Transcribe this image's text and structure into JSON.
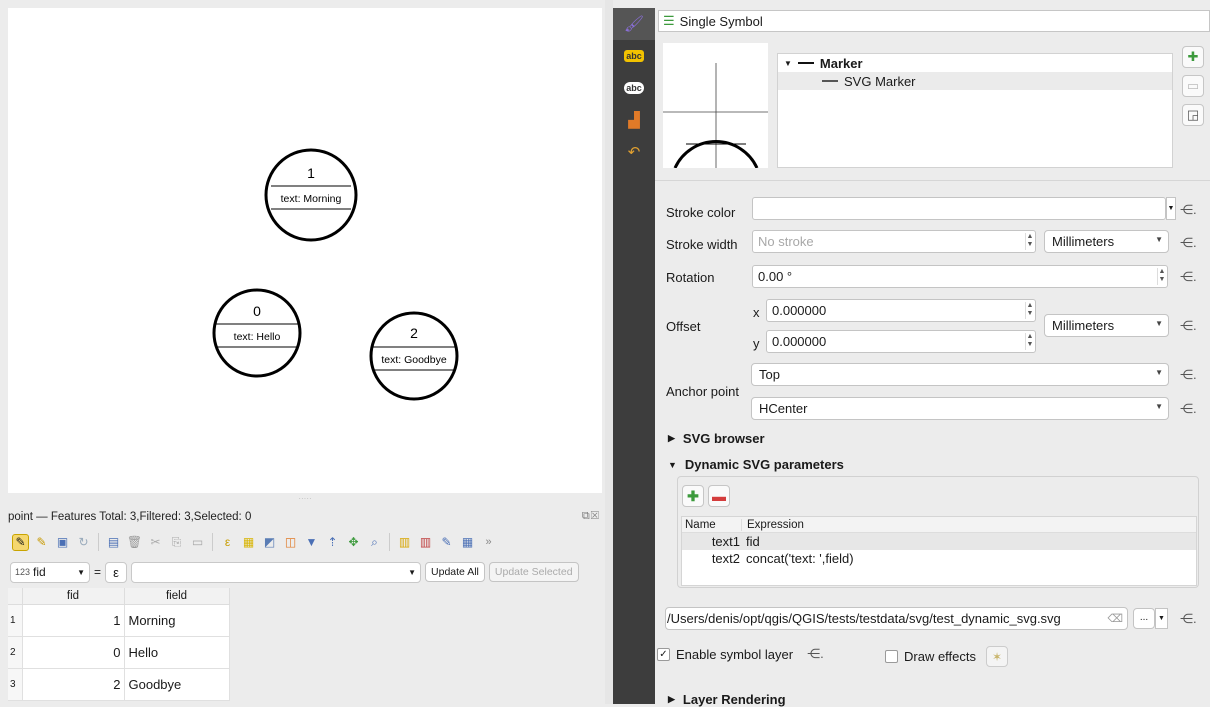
{
  "map": {
    "features": [
      {
        "number": "1",
        "label": "text: Morning"
      },
      {
        "number": "0",
        "label": "text: Hello"
      },
      {
        "number": "2",
        "label": "text: Goodbye"
      }
    ]
  },
  "attribute_table": {
    "title": "point — Features Total: 3,Filtered: 3,Selected: 0",
    "filter_field": "fid",
    "filter_field_type": "123",
    "filter_operator": "=",
    "expression_icon": "ε",
    "update_all": "Update All",
    "update_selected": "Update Selected",
    "columns": [
      "fid",
      "field"
    ],
    "rows": [
      {
        "num": "1",
        "fid": "1",
        "field": "Morning"
      },
      {
        "num": "2",
        "fid": "0",
        "field": "Hello"
      },
      {
        "num": "3",
        "fid": "2",
        "field": "Goodbye"
      }
    ]
  },
  "sidebar": {
    "tabs": [
      {
        "name": "symbology",
        "icon": "paintbrush-icon"
      },
      {
        "name": "labels",
        "text": "abc"
      },
      {
        "name": "masks",
        "text": "abc"
      },
      {
        "name": "3d-view",
        "icon": "stack-icon"
      },
      {
        "name": "history",
        "icon": "undo-icon"
      }
    ]
  },
  "symbology": {
    "renderer": "Single Symbol",
    "tree": {
      "root": "Marker",
      "child": "SVG Marker"
    },
    "stroke_color_label": "Stroke color",
    "stroke_width_label": "Stroke width",
    "stroke_width_placeholder": "No stroke",
    "unit": "Millimeters",
    "rotation_label": "Rotation",
    "rotation_value": "0.00 °",
    "offset_label": "Offset",
    "offset_x_label": "x",
    "offset_x": "0.000000",
    "offset_y_label": "y",
    "offset_y": "0.000000",
    "offset_unit": "Millimeters",
    "anchor_label": "Anchor point",
    "anchor_vertical": "Top",
    "anchor_horizontal": "HCenter",
    "svg_browser": "SVG browser",
    "dynamic_params": "Dynamic SVG parameters",
    "params_columns": [
      "Name",
      "Expression"
    ],
    "params": [
      {
        "name": "text1",
        "expression": "fid"
      },
      {
        "name": "text2",
        "expression": "concat('text: ',field)"
      }
    ],
    "svg_path": "/Users/denis/opt/qgis/QGIS/tests/testdata/svg/test_dynamic_svg.svg",
    "browse_button": "...",
    "enable_layer_label": "Enable symbol layer",
    "enable_layer_checked": true,
    "draw_effects_label": "Draw effects",
    "draw_effects_checked": false,
    "layer_rendering": "Layer Rendering"
  },
  "colors": {
    "sidebar_bg": "#3d3d3d",
    "green_icon": "#3c9a3c",
    "red_icon": "#d43c3c"
  }
}
